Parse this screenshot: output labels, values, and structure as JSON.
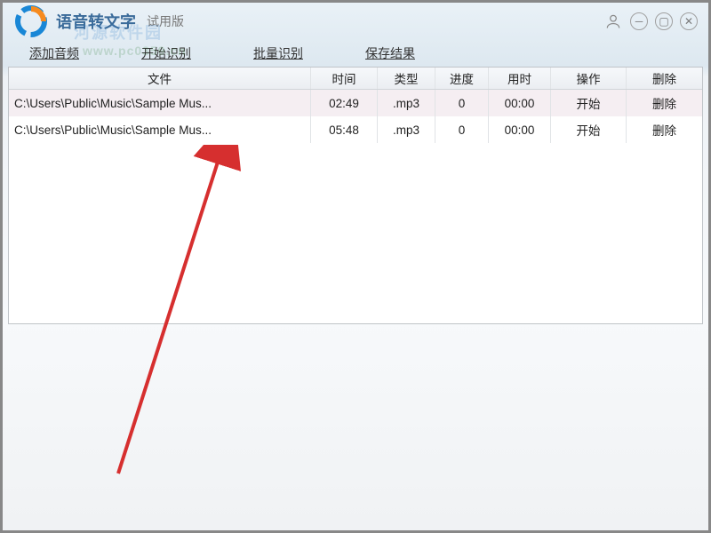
{
  "titlebar": {
    "app_title": "语音转文字",
    "trial_tag": "试用版"
  },
  "watermark": {
    "text": "河源软件园",
    "url": "www.pc0359.cn"
  },
  "toolbar": {
    "add_audio": "添加音频",
    "start_recognize": "开始识别",
    "batch_recognize": "批量识别",
    "save_results": "保存结果"
  },
  "grid": {
    "headers": {
      "file": "文件",
      "time": "时间",
      "type": "类型",
      "progress": "进度",
      "used": "用时",
      "operate": "操作",
      "delete": "删除"
    },
    "rows": [
      {
        "file": "C:\\Users\\Public\\Music\\Sample Mus...",
        "time": "02:49",
        "type": ".mp3",
        "progress": "0",
        "used": "00:00",
        "operate": "开始",
        "delete": "删除"
      },
      {
        "file": "C:\\Users\\Public\\Music\\Sample Mus...",
        "time": "05:48",
        "type": ".mp3",
        "progress": "0",
        "used": "00:00",
        "operate": "开始",
        "delete": "删除"
      }
    ]
  },
  "colors": {
    "arrow": "#d62f2f"
  }
}
